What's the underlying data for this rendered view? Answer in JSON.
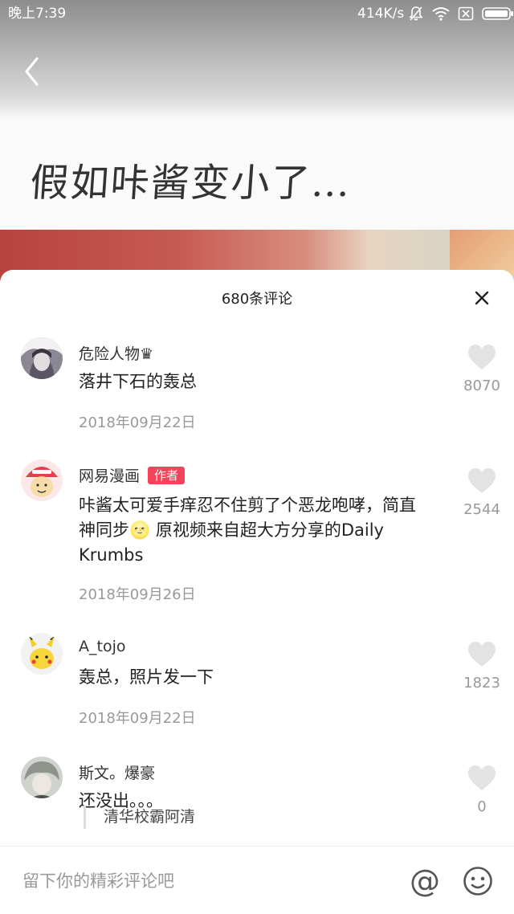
{
  "status_bar": {
    "time": "晚上7:39",
    "network_speed": "414K/s",
    "icons": [
      "muted-bell-icon",
      "wifi-icon",
      "no-sim-icon",
      "battery-icon"
    ]
  },
  "video": {
    "back_icon": "chevron-left-icon",
    "title": "假如咔酱变小了…"
  },
  "sheet": {
    "comment_count": "680条评论",
    "close_icon": "close-icon"
  },
  "comments": [
    {
      "username": "危险人物♛",
      "content": "落井下石的轰总",
      "date": "2018年09月22日",
      "likes": "8070",
      "avatar": "avatar-dark-hair"
    },
    {
      "username": "网易漫画",
      "badge": "作者",
      "content": "咔酱太可爱手痒忍不住剪了个恶龙咆哮，简直神同步🌝 原视频来自超大方分享的Daily Krumbs",
      "date": "2018年09月26日",
      "likes": "2544",
      "avatar": "avatar-netease-logo"
    },
    {
      "username": "A_tojo",
      "content": "轰总，照片发一下",
      "date": "2018年09月22日",
      "likes": "1823",
      "avatar": "avatar-pikachu"
    },
    {
      "username": "斯文。爆豪",
      "content": "还没出。。。",
      "likes": "0",
      "avatar": "avatar-grey-hair"
    }
  ],
  "reply_preview": "清华校霸阿清",
  "input_bar": {
    "placeholder": "留下你的精彩评论吧",
    "mention_label": "@",
    "emoji_icon": "emoji-icon"
  },
  "colors": {
    "author_badge": "#f1445a",
    "secondary_text": "#999999",
    "like_icon": "#e3e3e3"
  }
}
